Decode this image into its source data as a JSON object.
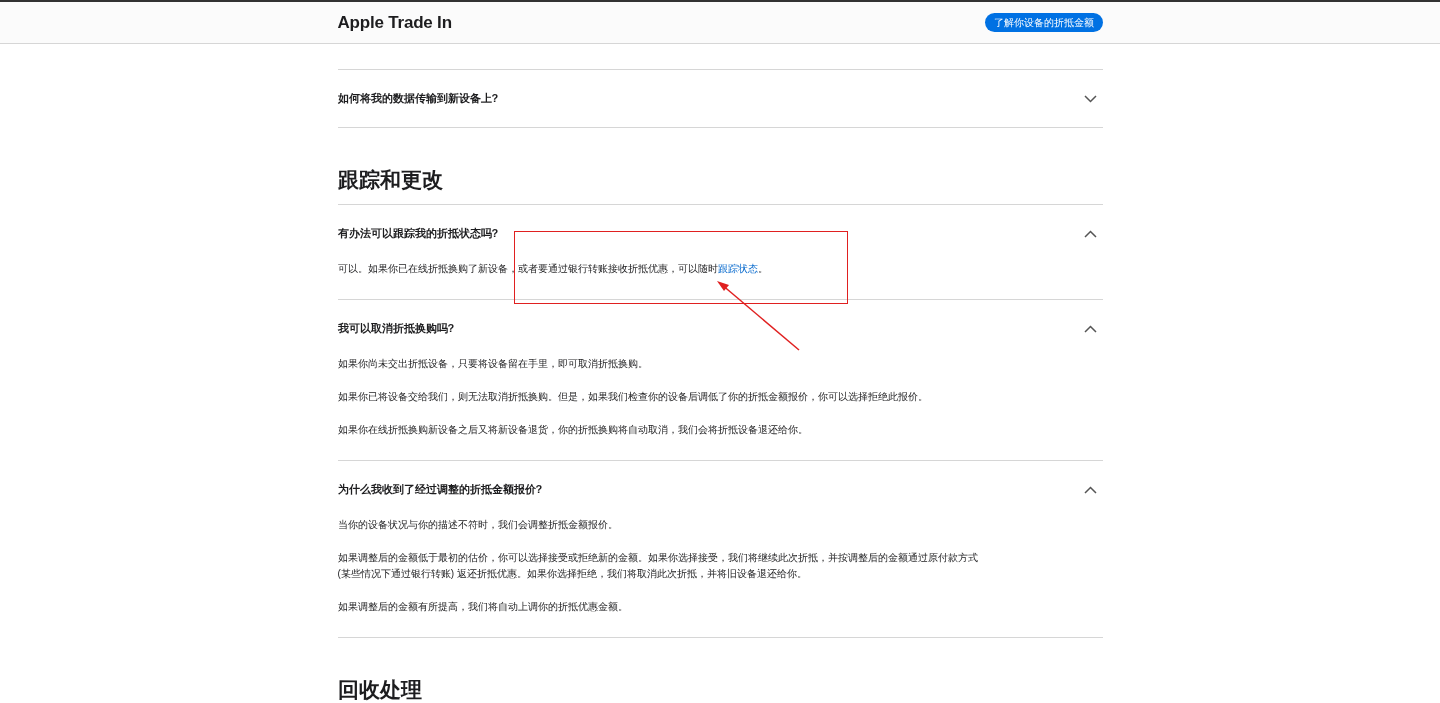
{
  "header": {
    "title": "Apple Trade In",
    "button": "了解你设备的折抵金额"
  },
  "blocks": [
    {
      "kind": "faq",
      "question": "如何将我的数据传输到新设备上?",
      "expanded": false
    },
    {
      "kind": "heading",
      "text": "跟踪和更改"
    },
    {
      "kind": "faq",
      "question": "有办法可以跟踪我的折抵状态吗?",
      "expanded": true,
      "answer": [
        {
          "text": "可以。如果你已在线折抵换购了新设备，或者要通过银行转账接收折抵优惠，可以随时",
          "link": "跟踪状态",
          "after": "。"
        }
      ]
    },
    {
      "kind": "faq",
      "question": "我可以取消折抵换购吗?",
      "expanded": true,
      "answer": [
        {
          "text": "如果你尚未交出折抵设备，只要将设备留在手里，即可取消折抵换购。"
        },
        {
          "text": "如果你已将设备交给我们，则无法取消折抵换购。但是，如果我们检查你的设备后调低了你的折抵金额报价，你可以选择拒绝此报价。"
        },
        {
          "text": "如果你在线折抵换购新设备之后又将新设备退货，你的折抵换购将自动取消，我们会将折抵设备退还给你。"
        }
      ]
    },
    {
      "kind": "faq",
      "question": "为什么我收到了经过调整的折抵金额报价?",
      "expanded": true,
      "answer": [
        {
          "text": "当你的设备状况与你的描述不符时，我们会调整折抵金额报价。"
        },
        {
          "text": "如果调整后的金额低于最初的估价，你可以选择接受或拒绝新的金额。如果你选择接受，我们将继续此次折抵，并按调整后的金额通过原付款方式 (某些情况下通过银行转账) 返还折抵优惠。如果你选择拒绝，我们将取消此次折抵，并将旧设备退还给你。"
        },
        {
          "text": "如果调整后的金额有所提高，我们将自动上调你的折抵优惠金额。"
        }
      ]
    },
    {
      "kind": "heading",
      "text": "回收处理"
    }
  ]
}
